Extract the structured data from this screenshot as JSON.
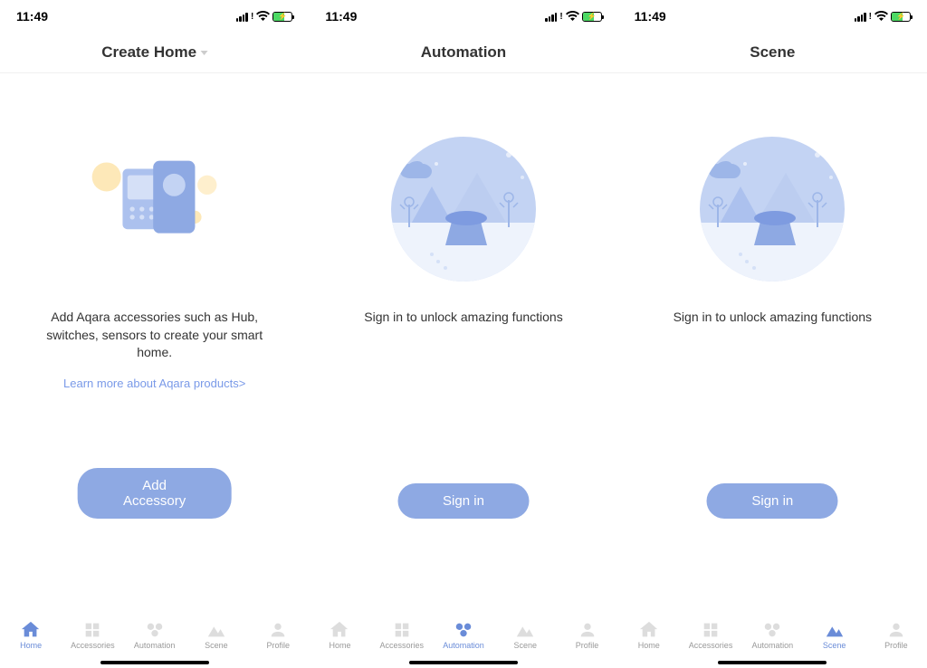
{
  "status": {
    "time": "11:49"
  },
  "screen1": {
    "header": "Create Home",
    "message": "Add Aqara accessories such as Hub, switches, sensors to create your smart home.",
    "link": "Learn more about Aqara products>",
    "button": "Add Accessory",
    "active_tab": 0
  },
  "screen2": {
    "header": "Automation",
    "message": "Sign in to unlock amazing functions",
    "button": "Sign in",
    "active_tab": 2
  },
  "screen3": {
    "header": "Scene",
    "message": "Sign in to unlock amazing functions",
    "button": "Sign in",
    "active_tab": 3
  },
  "tabs": {
    "home": "Home",
    "accessories": "Accessories",
    "automation": "Automation",
    "scene": "Scene",
    "profile": "Profile"
  }
}
